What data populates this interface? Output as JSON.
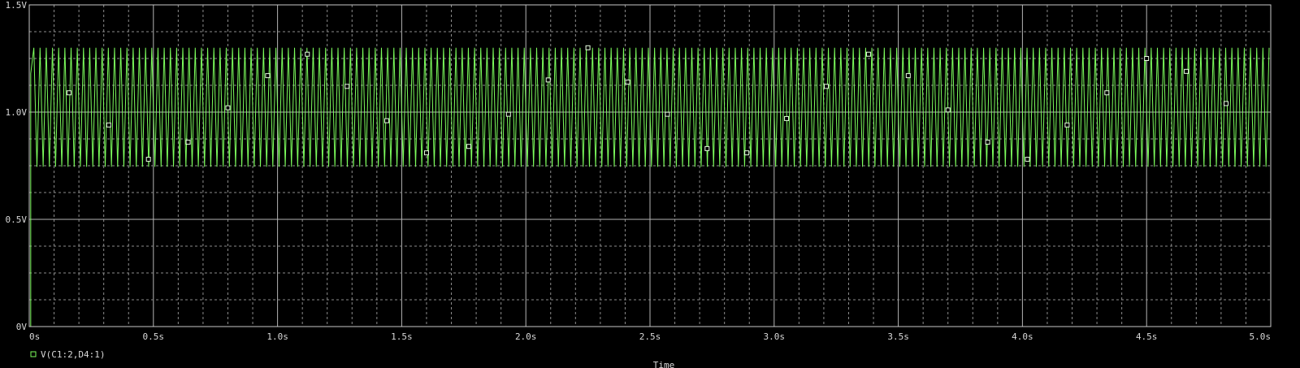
{
  "chart_data": {
    "type": "line",
    "title": "",
    "xlabel": "Time",
    "ylabel": "",
    "xlim": [
      0,
      5.0
    ],
    "ylim": [
      0,
      1.5
    ],
    "grid": true,
    "legend_placement": "bottom-left",
    "x_tick_values": [
      0,
      0.5,
      1.0,
      1.5,
      2.0,
      2.5,
      3.0,
      3.5,
      4.0,
      4.5,
      5.0
    ],
    "x_tick_labels": [
      "0s",
      "0.5s",
      "1.0s",
      "1.5s",
      "2.0s",
      "2.5s",
      "3.0s",
      "3.5s",
      "4.0s",
      "4.5s",
      "5.0s"
    ],
    "y_tick_values": [
      0,
      0.5,
      1.0,
      1.5
    ],
    "y_tick_labels": [
      "0V",
      "0.5V",
      "1.0V",
      "1.5V"
    ],
    "series": [
      {
        "name": "V(C1:2,D4:1)",
        "color": "#7CFC5C",
        "marker": "square",
        "signal": {
          "kind": "oscillation",
          "initial_value": 0,
          "start_time": 0.006,
          "rise_to": 1.18,
          "min": 0.745,
          "max": 1.3,
          "cycles_in_range": 200
        },
        "marker_points": [
          [
            0.16,
            1.09
          ],
          [
            0.32,
            0.94
          ],
          [
            0.48,
            0.78
          ],
          [
            0.64,
            0.86
          ],
          [
            0.8,
            1.02
          ],
          [
            0.96,
            1.17
          ],
          [
            1.12,
            1.27
          ],
          [
            1.28,
            1.12
          ],
          [
            1.44,
            0.96
          ],
          [
            1.6,
            0.81
          ],
          [
            1.77,
            0.84
          ],
          [
            1.93,
            0.99
          ],
          [
            2.09,
            1.15
          ],
          [
            2.25,
            1.3
          ],
          [
            2.41,
            1.14
          ],
          [
            2.57,
            0.99
          ],
          [
            2.73,
            0.83
          ],
          [
            2.89,
            0.81
          ],
          [
            3.05,
            0.97
          ],
          [
            3.21,
            1.12
          ],
          [
            3.38,
            1.27
          ],
          [
            3.54,
            1.17
          ],
          [
            3.7,
            1.01
          ],
          [
            3.86,
            0.86
          ],
          [
            4.02,
            0.78
          ],
          [
            4.18,
            0.94
          ],
          [
            4.34,
            1.09
          ],
          [
            4.5,
            1.25
          ],
          [
            4.66,
            1.19
          ],
          [
            4.82,
            1.04
          ]
        ]
      }
    ]
  },
  "colors": {
    "background": "#000000",
    "frame": "#c8c8c8",
    "grid_major": "#b4b4b4",
    "grid_minor": "#8c8c8c",
    "text": "#d8d8d8"
  }
}
